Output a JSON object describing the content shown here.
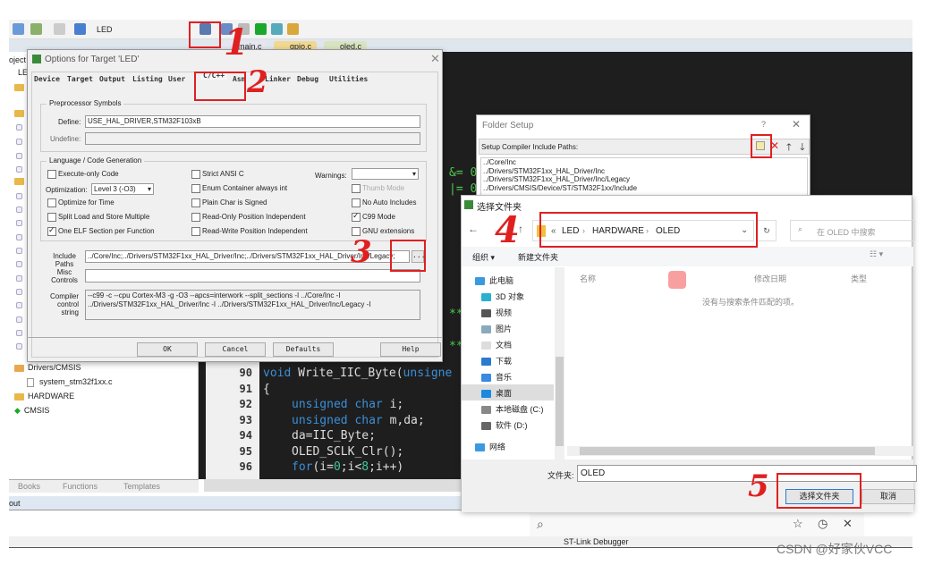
{
  "toolbar": {
    "target": "LED"
  },
  "file_tabs": [
    "main.c",
    "gpio.c",
    "oled.c"
  ],
  "project": {
    "header": "oject",
    "root": "LED",
    "items": [
      "Drivers/CMSIS",
      "system_stm32f1xx.c",
      "HARDWARE",
      "CMSIS"
    ],
    "bottom_tabs": [
      "Books",
      "Functions",
      "Templates"
    ]
  },
  "output": {
    "label": "out"
  },
  "status": {
    "debugger": "ST-Link Debugger"
  },
  "editor": {
    "line_numbers": [
      "90",
      "91",
      "92",
      "93",
      "94",
      "95",
      "96"
    ],
    "lines": [
      {
        "kw": "void",
        "rest": " Write_IIC_Byte(",
        "kw2": "unsigne"
      },
      {
        "rest": "{"
      },
      {
        "kw": "unsigned char",
        "rest": " i;"
      },
      {
        "kw": "unsigned char",
        "rest": " m,da;"
      },
      {
        "rest": "da=IIC_Byte;"
      },
      {
        "rest": "OLED_SCLK_Clr();"
      },
      {
        "kw": "for",
        "rest": "(i=",
        "n1": "0",
        "r2": ";i<",
        "n2": "8",
        "r3": ";i++)"
      }
    ],
    "frag1": "&= 0",
    "frag2": "|= 0",
    "frag3": "**",
    "frag4": "**"
  },
  "options_dialog": {
    "title": "Options for Target 'LED'",
    "tabs": [
      "Device",
      "Target",
      "Output",
      "Listing",
      "User",
      "C/C++",
      "Asm",
      "Linker",
      "Debug",
      "Utilities"
    ],
    "active_tab": "C/C++",
    "preproc": {
      "title": "Preprocessor Symbols",
      "define_label": "Define:",
      "define_value": "USE_HAL_DRIVER,STM32F103xB",
      "undefine_label": "Undefine:",
      "undefine_value": ""
    },
    "lang": {
      "title": "Language / Code Generation",
      "execute_only": "Execute-only Code",
      "optimization_label": "Optimization:",
      "optimization_value": "Level 3 (-O3)",
      "optimize_time": "Optimize for Time",
      "split_load": "Split Load and Store Multiple",
      "one_elf": "One ELF Section per Function",
      "strict_ansi": "Strict ANSI C",
      "enum_int": "Enum Container always int",
      "plain_char": "Plain Char is Signed",
      "ro_pos": "Read-Only Position Independent",
      "rw_pos": "Read-Write Position Independent",
      "warnings_label": "Warnings:",
      "warnings_value": "",
      "thumb": "Thumb Mode",
      "no_auto": "No Auto Includes",
      "c99": "C99 Mode",
      "gnu": "GNU extensions"
    },
    "include_label": "Include Paths",
    "include_value": "../Core/Inc;../Drivers/STM32F1xx_HAL_Driver/Inc;../Drivers/STM32F1xx_HAL_Driver/Inc/Legacy;",
    "browse_label": "...",
    "misc_label": "Misc Controls",
    "misc_value": "",
    "compiler_label": "Compiler control string",
    "compiler_value": "--c99 -c --cpu Cortex-M3 -g -O3 --apcs=interwork --split_sections -I ../Core/Inc -I ../Drivers/STM32F1xx_HAL_Driver/Inc -I ../Drivers/STM32F1xx_HAL_Driver/Inc/Legacy -I",
    "buttons": {
      "ok": "OK",
      "cancel": "Cancel",
      "defaults": "Defaults",
      "help": "Help"
    }
  },
  "folder_setup": {
    "title": "Folder Setup",
    "help": "?",
    "label": "Setup Compiler Include Paths:",
    "paths": [
      "../Core/Inc",
      "../Drivers/STM32F1xx_HAL_Driver/Inc",
      "../Drivers/STM32F1xx_HAL_Driver/Inc/Legacy",
      "../Drivers/CMSIS/Device/ST/STM32F1xx/Include"
    ]
  },
  "folder_picker": {
    "title": "选择文件夹",
    "breadcrumb": [
      "LED",
      "HARDWARE",
      "OLED"
    ],
    "search_placeholder": "在 OLED 中搜索",
    "organize": "组织 ▾",
    "new_folder": "新建文件夹",
    "nav": [
      "此电脑",
      "3D 对象",
      "视频",
      "图片",
      "文档",
      "下载",
      "音乐",
      "桌面",
      "本地磁盘 (C:)",
      "软件 (D:)",
      "网络"
    ],
    "nav_selected": "桌面",
    "columns": [
      "名称",
      "修改日期",
      "类型"
    ],
    "empty": "没有与搜索条件匹配的项。",
    "folder_label": "文件夹:",
    "folder_value": "OLED",
    "select_button": "选择文件夹",
    "cancel_button": "取消"
  },
  "annotations": [
    "1",
    "2",
    "3",
    "4",
    "5"
  ],
  "watermark": "CSDN @好家伙VCC",
  "colors": {
    "annotation": "#e02020",
    "editor_bg": "#1e1e1e",
    "keyword": "#3a8fd8"
  }
}
